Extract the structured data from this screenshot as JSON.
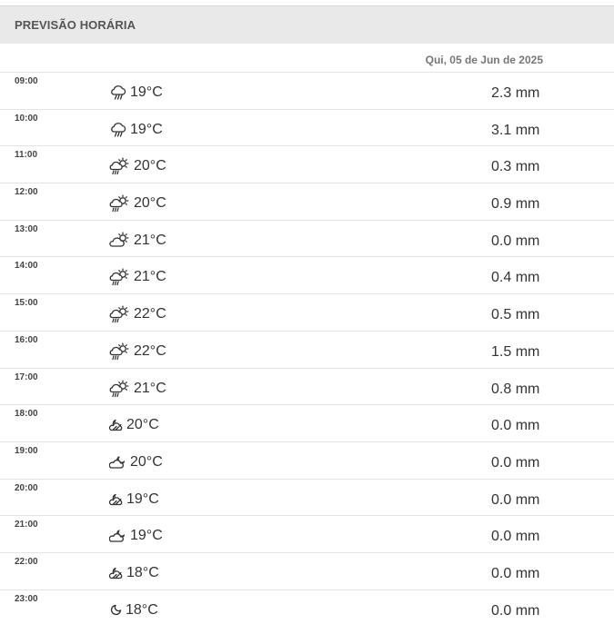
{
  "header": {
    "title": "PREVISÃO HORÁRIA"
  },
  "date_label": "Qui, 05 de Jun de 2025",
  "rows": [
    {
      "time": "09:00",
      "temp": "19°C",
      "precip": "2.3 mm",
      "icon": "cloud-rain-icon"
    },
    {
      "time": "10:00",
      "temp": "19°C",
      "precip": "3.1 mm",
      "icon": "cloud-rain-icon"
    },
    {
      "time": "11:00",
      "temp": "20°C",
      "precip": "0.3 mm",
      "icon": "sun-cloud-rain-icon"
    },
    {
      "time": "12:00",
      "temp": "20°C",
      "precip": "0.9 mm",
      "icon": "sun-cloud-rain-icon"
    },
    {
      "time": "13:00",
      "temp": "21°C",
      "precip": "0.0 mm",
      "icon": "partly-cloudy-icon"
    },
    {
      "time": "14:00",
      "temp": "21°C",
      "precip": "0.4 mm",
      "icon": "sun-cloud-rain-icon"
    },
    {
      "time": "15:00",
      "temp": "22°C",
      "precip": "0.5 mm",
      "icon": "sun-cloud-rain-icon"
    },
    {
      "time": "16:00",
      "temp": "22°C",
      "precip": "1.5 mm",
      "icon": "sun-cloud-rain-icon"
    },
    {
      "time": "17:00",
      "temp": "21°C",
      "precip": "0.8 mm",
      "icon": "sun-cloud-rain-icon"
    },
    {
      "time": "18:00",
      "temp": "20°C",
      "precip": "0.0 mm",
      "icon": "moon-cloud-hatched-icon"
    },
    {
      "time": "19:00",
      "temp": "20°C",
      "precip": "0.0 mm",
      "icon": "moon-cloud-icon"
    },
    {
      "time": "20:00",
      "temp": "19°C",
      "precip": "0.0 mm",
      "icon": "moon-cloud-hatched-icon"
    },
    {
      "time": "21:00",
      "temp": "19°C",
      "precip": "0.0 mm",
      "icon": "moon-cloud-icon"
    },
    {
      "time": "22:00",
      "temp": "18°C",
      "precip": "0.0 mm",
      "icon": "moon-cloud-hatched-icon"
    },
    {
      "time": "23:00",
      "temp": "18°C",
      "precip": "0.0 mm",
      "icon": "moon-icon"
    }
  ]
}
